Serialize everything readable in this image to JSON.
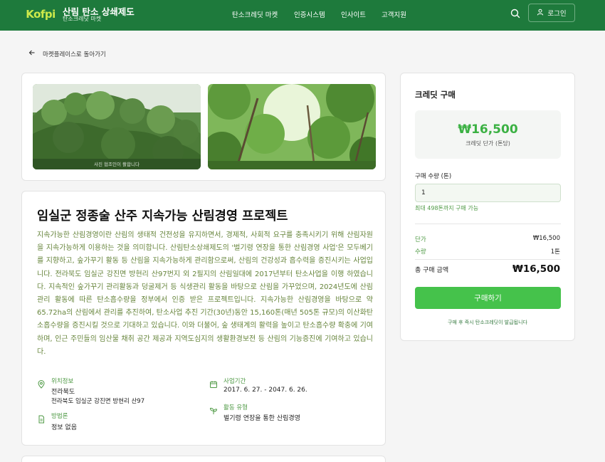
{
  "header": {
    "logo_text": "Kofpi",
    "brand_title": "산림 탄소 상쇄제도",
    "brand_sub": "탄소크레딧 마켓",
    "nav": [
      {
        "label": "탄소크레딧 마켓"
      },
      {
        "label": "인증시스템"
      },
      {
        "label": "인사이트"
      },
      {
        "label": "고객지원"
      }
    ],
    "search_icon": "search-icon",
    "login_label": "로그인"
  },
  "back_label": "마켓플레이스로 돌아가기",
  "gallery": {
    "caption": "사진 협조인이 촬합니다"
  },
  "project": {
    "title": "임실군 정종술 산주 지속가능 산림경영 프로젝트",
    "description": "지속가능한 산림경영이란 산림의 생태적 건전성을 유지하면서, 경제적, 사회적 요구를 충족시키기 위해 산림자원을 지속가능하게 이용하는 것을 의미합니다. 산림탄소상쇄제도의 '벌기령 연장을 통한 산림경영 사업'은 모두베기를 지향하고, 숲가꾸기 활동 등 산림을 지속가능하게 관리함으로써, 산림의 건강성과 흡수력을 증진시키는 사업입니다. 전라북도 임실군 강진면 방현리 산97번지 외 2필지의 산림일대에 2017년부터 탄소사업을 이행 하였습니다. 지속적인 숲가꾸기 관리활동과 덩굴제거 등 식생관리 활동을 바탕으로 산림을 가꾸었으며, 2024년도에 산림관리 활동에 따른 탄소흡수량을 정부에서 인증 받은 프로젝트입니다. 지속가능한 산림경영을 바탕으로 약 65.72ha의 산림에서 관리를 추진하여, 탄소사업 추진 기간(30년)동안 15,160톤(매년 505톤 규모)의 이산화탄소흡수량을 증진시킬 것으로 기대하고 있습니다. 이와 더불어, 숲 생태계의 활력을 높이고 탄소흡수량 확충에 기여하며, 인근 주민들의 임산물 채취 공간 제공과 지역도심지의 생활환경보전 등 산림의 기능증진에 기여하고 있습니다.",
    "info": {
      "location_label": "위치정보",
      "location_region": "전라북도",
      "location_detail": "전라북도 임실군 강진면 방현리 산97",
      "period_label": "사업기간",
      "period_value": "2017. 6. 27. - 2047. 6. 26.",
      "law_label": "방법론",
      "law_value": "정보 없음",
      "activity_label": "활동 유형",
      "activity_value": "벌기령 연장을 통한 산림경영"
    }
  },
  "purchase": {
    "title": "크레딧 구매",
    "price": "₩16,500",
    "price_sub": "크레딧 단가 (톤당)",
    "qty_label": "구매 수량 (톤)",
    "qty_value": "1",
    "qty_hint": "최대 498톤까지 구매 가능",
    "unit_label": "단가",
    "unit_value": "₩16,500",
    "qty_row_label": "수량",
    "qty_row_value": "1톤",
    "total_label": "총 구매 금액",
    "total_value": "₩16,500",
    "buy_label": "구매하기",
    "buy_note": "구매 후 즉시 탄소크레딧이 발급됩니다"
  },
  "colors": {
    "header_bg": "#1e7a3c",
    "accent_green": "#45c24b",
    "price_green": "#3bb143",
    "desc_text": "#67853c"
  }
}
